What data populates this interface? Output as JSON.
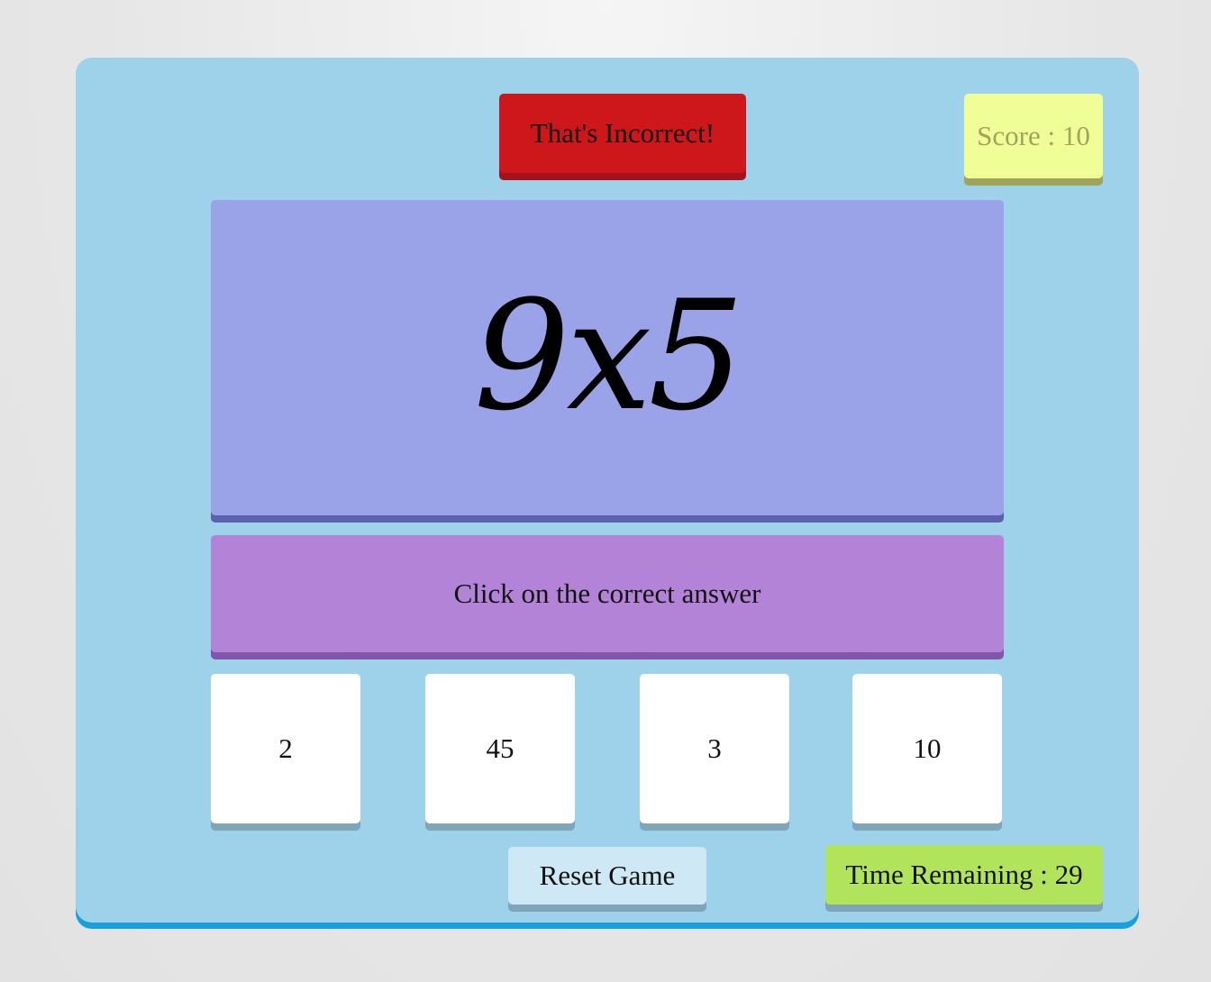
{
  "feedback": {
    "text": "That's Incorrect!",
    "color": "#cd171b"
  },
  "score": {
    "text": "Score : 10"
  },
  "question": {
    "text": "9x5"
  },
  "instruction": {
    "text": "Click on the correct answer"
  },
  "choices": [
    {
      "label": "2"
    },
    {
      "label": "45"
    },
    {
      "label": "3"
    },
    {
      "label": "10"
    }
  ],
  "reset": {
    "label": "Reset Game"
  },
  "timer": {
    "text": "Time Remaining : 29"
  },
  "colors": {
    "container": "#9dd2ea",
    "question_box": "#9ba3e8",
    "instruction_box": "#b283d7",
    "score_box": "#f0fe98",
    "timer_box": "#b1e45b",
    "reset_button": "#cfe8f5"
  }
}
